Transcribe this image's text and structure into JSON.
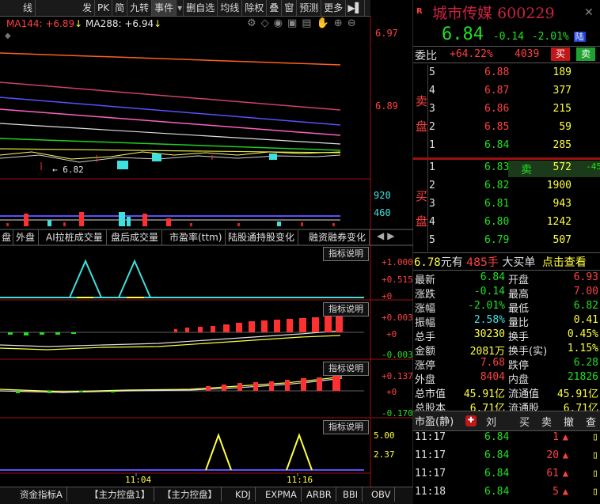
{
  "toolbar": {
    "items": [
      "线",
      "发",
      "PK",
      "简",
      "九转",
      "事件",
      "删自选",
      "均线",
      "除权",
      "叠",
      "窗",
      "预测",
      "更多"
    ]
  },
  "ma_legend": {
    "ma144": "MA144: +6.89",
    "ma288": "MA288: +6.94"
  },
  "price_axis": {
    "top": "6.97",
    "mid": "6.89"
  },
  "low_mark": "6.82",
  "volume_axis": {
    "v1": "920",
    "v2": "460"
  },
  "tabs": [
    "盘",
    "外盘",
    "AI拉桩成交量",
    "盘后成交量",
    "市盈率(ttm)",
    "陆股通持股变化",
    "融资融券变化"
  ],
  "indicator_label": "指标说明",
  "panel1_axis": [
    "+1.000",
    "+0.515",
    "+0"
  ],
  "panel2_axis": [
    "+0.003",
    "+0",
    "-0.003"
  ],
  "panel3_axis": [
    "+0.137",
    "+0",
    "-0.170"
  ],
  "panel4_axis": [
    "5.00",
    "2.37"
  ],
  "time_axis": [
    "11:04",
    "11:16"
  ],
  "bottom_tabs": [
    "资金指标A",
    "【主力控盘1】",
    "【主力控盘】",
    "KDJ",
    "EXPMA",
    "ARBR",
    "BBI",
    "OBV"
  ],
  "stock": {
    "name": "城市传媒",
    "code": "600229",
    "price": "6.84",
    "change": "-0.14",
    "pct": "-2.01%",
    "market": "陆"
  },
  "weibi": {
    "label": "委比",
    "value": "+64.22%",
    "diff": "4039",
    "buy": "买",
    "sell": "卖"
  },
  "asks": [
    {
      "n": "5",
      "price": "6.88",
      "vol": "189"
    },
    {
      "n": "4",
      "price": "6.87",
      "vol": "377"
    },
    {
      "n": "3",
      "price": "6.86",
      "vol": "215"
    },
    {
      "n": "2",
      "price": "6.85",
      "vol": "59"
    },
    {
      "n": "1",
      "price": "6.84",
      "vol": "285"
    }
  ],
  "ask_label": [
    "卖",
    "盘"
  ],
  "bids": [
    {
      "n": "1",
      "price": "6.83",
      "vol": "572",
      "extra": "-45"
    },
    {
      "n": "2",
      "price": "6.82",
      "vol": "1900"
    },
    {
      "n": "3",
      "price": "6.81",
      "vol": "943"
    },
    {
      "n": "4",
      "price": "6.80",
      "vol": "1242"
    },
    {
      "n": "5",
      "price": "6.79",
      "vol": "507"
    }
  ],
  "bid_label": [
    "买",
    "盘"
  ],
  "bid_sell_tag": "卖",
  "bigorder": {
    "price": "6.78",
    "text1": "元有",
    "hands": "485手",
    "text2": "大买单",
    "link": "点击查看"
  },
  "stats_left": [
    {
      "label": "最新",
      "value": "6.84"
    },
    {
      "label": "涨跌",
      "value": "-0.14"
    },
    {
      "label": "涨幅",
      "value": "-2.01%"
    },
    {
      "label": "振幅",
      "value": "2.58%"
    },
    {
      "label": "总手",
      "value": "30230"
    },
    {
      "label": "金额",
      "value": "2081万"
    },
    {
      "label": "涨停",
      "value": "7.68"
    },
    {
      "label": "外盘",
      "value": "8404"
    },
    {
      "label": "总市值",
      "value": "45.91亿"
    },
    {
      "label": "总股本",
      "value": "6.71亿"
    },
    {
      "label": "市盈(静)",
      "value": ""
    }
  ],
  "stats_right": [
    {
      "label": "开盘",
      "value": "6.93"
    },
    {
      "label": "最高",
      "value": "7.00"
    },
    {
      "label": "最低",
      "value": "6.82"
    },
    {
      "label": "量比",
      "value": "0.41"
    },
    {
      "label": "换手",
      "value": "0.45%"
    },
    {
      "label": "换手(实)",
      "value": "1.15%"
    },
    {
      "label": "跌停",
      "value": "6.28"
    },
    {
      "label": "内盘",
      "value": "21826"
    },
    {
      "label": "流通值",
      "value": "45.91亿"
    },
    {
      "label": "流通股",
      "value": "6.71亿"
    }
  ],
  "tick_tabs": [
    "刘",
    "买",
    "卖",
    "撤",
    "查"
  ],
  "ticks": [
    {
      "time": "11:17",
      "price": "6.84",
      "vol": "1"
    },
    {
      "time": "11:17",
      "price": "6.84",
      "vol": "20"
    },
    {
      "time": "11:17",
      "price": "6.84",
      "vol": "61"
    },
    {
      "time": "11:18",
      "price": "6.84",
      "vol": "5"
    }
  ],
  "colors": {
    "up": "#ff3030",
    "down": "#20e020",
    "accent": "#cc2244",
    "cyan": "#40e0e0"
  }
}
